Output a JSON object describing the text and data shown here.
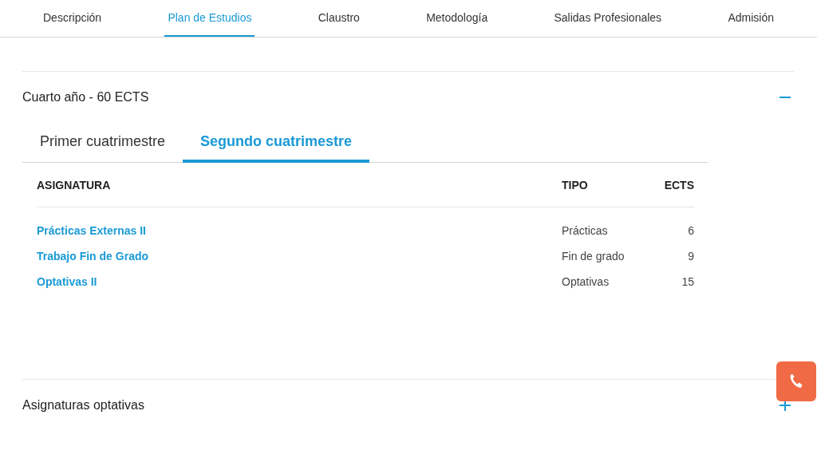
{
  "nav_tabs": [
    {
      "label": "Descripción",
      "selected": false
    },
    {
      "label": "Plan de Estudios",
      "selected": true
    },
    {
      "label": "Claustro",
      "selected": false
    },
    {
      "label": "Metodología",
      "selected": false
    },
    {
      "label": "Salidas Profesionales",
      "selected": false
    },
    {
      "label": "Admisión",
      "selected": false
    }
  ],
  "sections": [
    {
      "title": "Cuarto año - 60 ECTS",
      "expanded": true,
      "semester_tabs": [
        {
          "label": "Primer cuatrimestre",
          "selected": false
        },
        {
          "label": "Segundo cuatrimestre",
          "selected": true
        }
      ],
      "table": {
        "columns": [
          "ASIGNATURA",
          "TIPO",
          "ECTS"
        ],
        "rows": [
          {
            "subject": "Prácticas Externas II",
            "type": "Prácticas",
            "ects": "6"
          },
          {
            "subject": "Trabajo Fin de Grado",
            "type": "Fin de grado",
            "ects": "9"
          },
          {
            "subject": "Optativas II",
            "type": "Optativas",
            "ects": "15"
          }
        ]
      }
    },
    {
      "title": "Asignaturas optativas",
      "expanded": false
    }
  ]
}
